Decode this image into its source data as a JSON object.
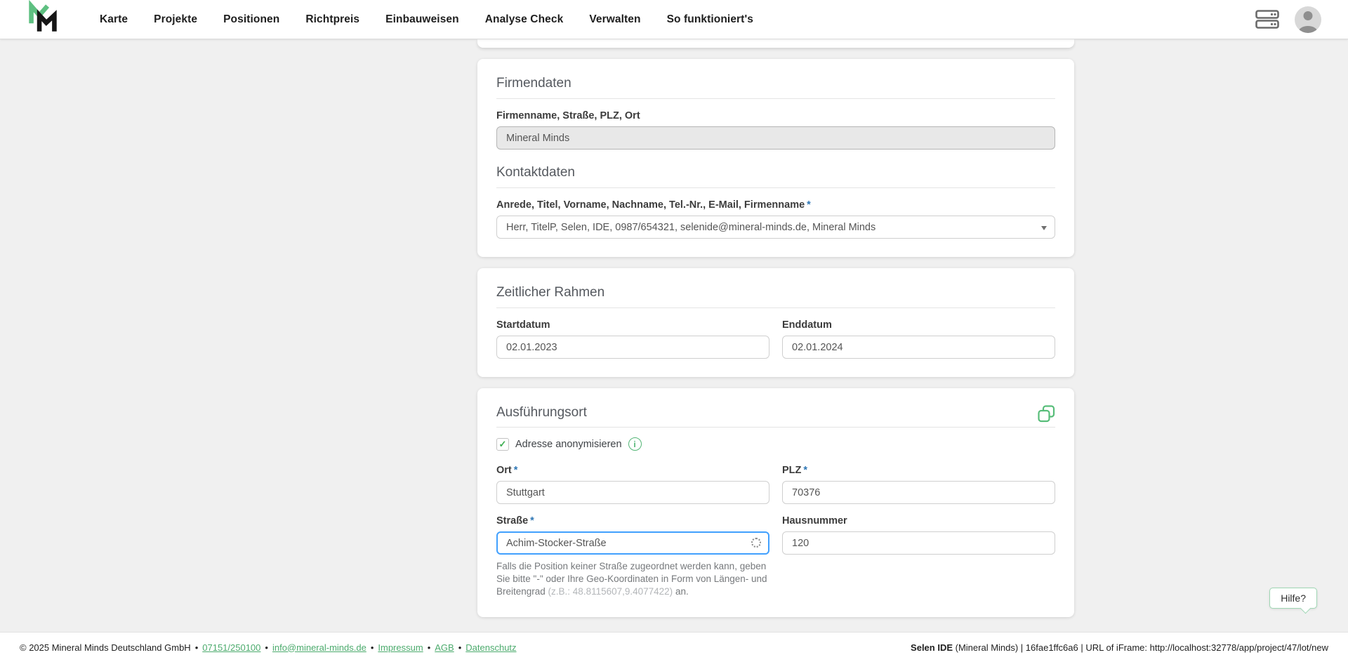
{
  "nav": {
    "items": [
      "Karte",
      "Projekte",
      "Positionen",
      "Richtpreis",
      "Einbauweisen",
      "Analyse Check",
      "Verwalten",
      "So funktioniert's"
    ]
  },
  "required_marker": "*",
  "cards": {
    "firmendaten": {
      "title": "Firmendaten",
      "company_label": "Firmenname, Straße, PLZ, Ort",
      "company_value": "Mineral Minds",
      "kontakt_title": "Kontaktdaten",
      "contact_label": "Anrede, Titel, Vorname, Nachname, Tel.-Nr., E-Mail, Firmenname",
      "contact_value": "Herr, TitelP, Selen, IDE, 0987/654321, selenide@mineral-minds.de, Mineral Minds"
    },
    "zeitraum": {
      "title": "Zeitlicher Rahmen",
      "start_label": "Startdatum",
      "start_value": "02.01.2023",
      "end_label": "Enddatum",
      "end_value": "02.01.2024"
    },
    "ausfuehrungsort": {
      "title": "Ausführungsort",
      "anonymize_label": "Adresse anonymisieren",
      "checkbox_check": "✓",
      "info_glyph": "i",
      "ort_label": "Ort",
      "ort_value": "Stuttgart",
      "plz_label": "PLZ",
      "plz_value": "70376",
      "strasse_label": "Straße",
      "strasse_value": "Achim-Stocker-Straße",
      "hausnummer_label": "Hausnummer",
      "hausnummer_value": "120",
      "hint_text": "Falls die Position keiner Straße zugeordnet werden kann, geben Sie bitte \"-\" oder Ihre Geo-Koordinaten in Form von Längen- und Breitengrad ",
      "hint_coords": "(z.B.: 48.8115607,9.4077422)",
      "hint_suffix": " an."
    }
  },
  "help_button": {
    "label": "Hilfe?"
  },
  "footer": {
    "copyright": "© 2025 Mineral Minds Deutschland GmbH",
    "separator": "•",
    "links": [
      "07151/250100",
      "info@mineral-minds.de",
      "Impressum",
      "AGB",
      "Datenschutz"
    ],
    "right_bold": "Selen IDE",
    "right_rest": " (Mineral Minds) | 16fae1ffc6a6 | URL of iFrame: http://localhost:32778/app/project/47/lot/new"
  },
  "colors": {
    "brand_green": "#52b575",
    "logo_green": "#5ec081",
    "focus_blue": "#41a0fe",
    "required_blue": "#2f77b5"
  }
}
